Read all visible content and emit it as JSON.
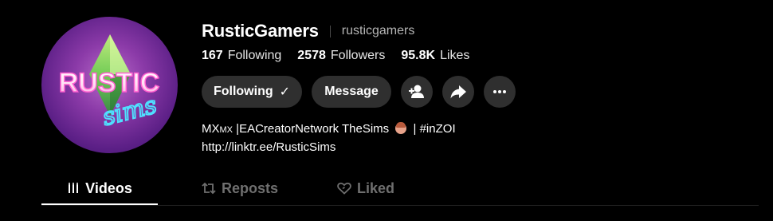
{
  "profile": {
    "display_name": "RusticGamers",
    "handle": "rusticgamers",
    "avatar_text_top": "RUSTIC",
    "avatar_text_bottom": "sims"
  },
  "stats": {
    "following": {
      "value": "167",
      "label": "Following"
    },
    "followers": {
      "value": "2578",
      "label": "Followers"
    },
    "likes": {
      "value": "95.8K",
      "label": "Likes"
    }
  },
  "actions": {
    "following_label": "Following",
    "following_check": "✓",
    "message_label": "Message",
    "icons": [
      "add-friend-icon",
      "share-icon",
      "more-icon"
    ]
  },
  "bio": {
    "line1_start": "MX",
    "line1_flag": "MX",
    "line1_rest": " |EACreatorNetwork TheSims ",
    "line1_end": " | #inZOI",
    "line2": "http://linktr.ee/RusticSims"
  },
  "tabs": [
    {
      "label": "Videos",
      "icon": "grid-lines-icon",
      "active": true
    },
    {
      "label": "Reposts",
      "icon": "repost-icon",
      "active": false
    },
    {
      "label": "Liked",
      "icon": "heart-outline-icon",
      "active": false
    }
  ],
  "colors": {
    "background": "#000000",
    "button_bg": "#2f2f2f",
    "inactive_tab": "#6f6f6f",
    "secondary_text": "#b5b5b5"
  }
}
